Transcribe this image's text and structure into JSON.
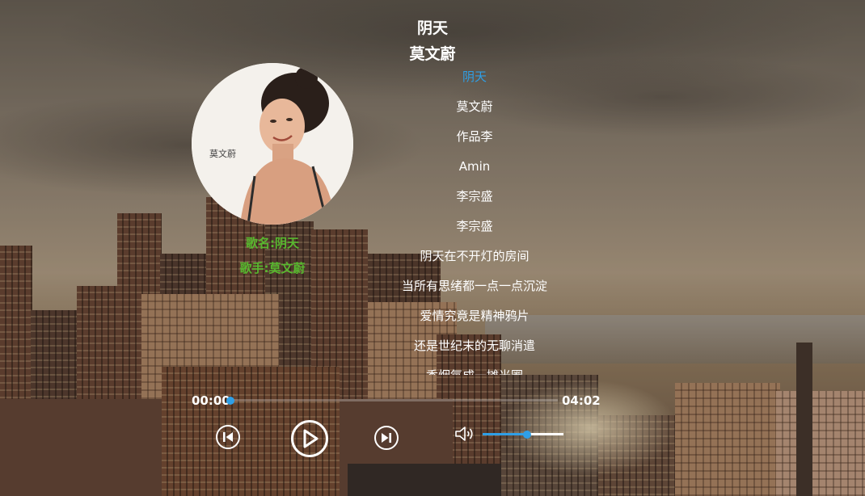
{
  "song": {
    "title": "阴天",
    "artist": "莫文蔚"
  },
  "cover": {
    "alt": "album-cover",
    "cover_text": "莫文蔚"
  },
  "info": {
    "name_label": "歌名:阴天",
    "singer_label": "歌手:莫文蔚"
  },
  "lyrics": {
    "active_index": 0,
    "lines": [
      "阴天",
      "莫文蔚",
      "作品李",
      "Amin",
      "李宗盛",
      "李宗盛",
      "阴天在不开灯的房间",
      "当所有思绪都一点一点沉淀",
      "爱情究竟是精神鸦片",
      "还是世纪末的无聊消遣",
      "香烟氧成一摊光圈"
    ]
  },
  "player": {
    "current_time": "00:00",
    "total_time": "04:02",
    "progress": 0.0,
    "volume": 0.55,
    "accent_color": "#2f9fe6",
    "info_color": "#58b82f"
  },
  "icons": {
    "prev": "skip-previous-icon",
    "play": "play-icon",
    "next": "skip-next-icon",
    "volume": "volume-icon"
  }
}
